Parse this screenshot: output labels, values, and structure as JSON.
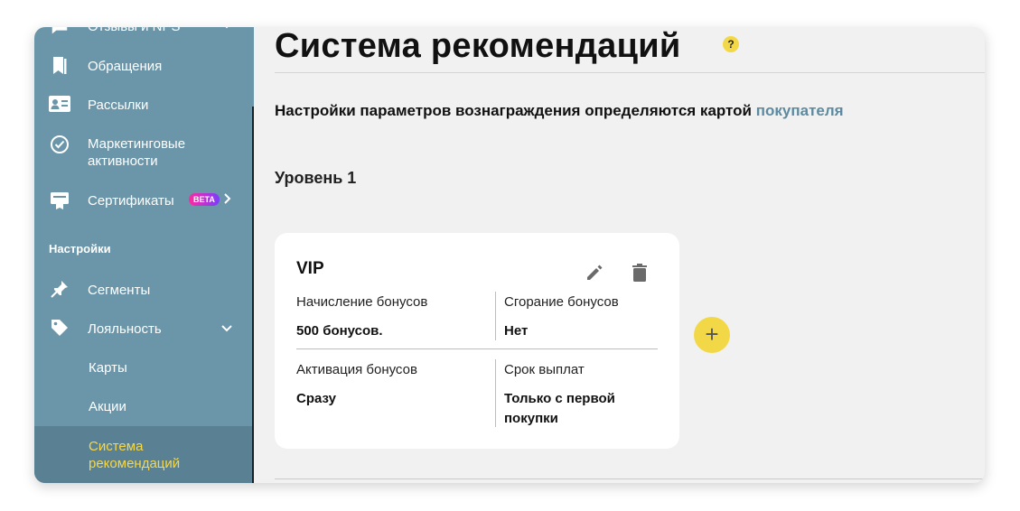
{
  "sidebar": {
    "items": [
      {
        "label": "Отзывы и NPS",
        "icon": "chat-icon"
      },
      {
        "label": "Обращения",
        "icon": "bookmark-icon"
      },
      {
        "label": "Рассылки",
        "icon": "contact-card-icon"
      },
      {
        "label": "Маркетинговые активности",
        "icon": "check-circle-icon"
      },
      {
        "label": "Сертификаты",
        "icon": "certificate-icon",
        "badge": "BETA"
      }
    ],
    "section_title": "Настройки",
    "settings_items": [
      {
        "label": "Сегменты",
        "icon": "pin-icon"
      },
      {
        "label": "Лояльность",
        "icon": "tag-icon"
      }
    ],
    "loyalty_sub": [
      "Карты",
      "Акции",
      "Система рекомендаций"
    ],
    "active_color": "#f5d84a",
    "bg_color": "#6b96a9"
  },
  "main": {
    "title": "Система рекомендаций",
    "help": "?",
    "info_text": "Настройки параметров вознаграждения определяются картой",
    "info_link": "покупателя",
    "level_title": "Уровень 1",
    "card": {
      "title": "VIP",
      "cells": [
        {
          "label": "Начисление бонусов",
          "value": "500 бонусов."
        },
        {
          "label": "Сгорание бонусов",
          "value": "Нет"
        },
        {
          "label": "Активация бонусов",
          "value": "Сразу"
        },
        {
          "label": "Срок выплат",
          "value": "Только с первой покупки"
        }
      ]
    },
    "add_label": "+",
    "accent": "#f2d847",
    "link_color": "#5c8aa0"
  }
}
